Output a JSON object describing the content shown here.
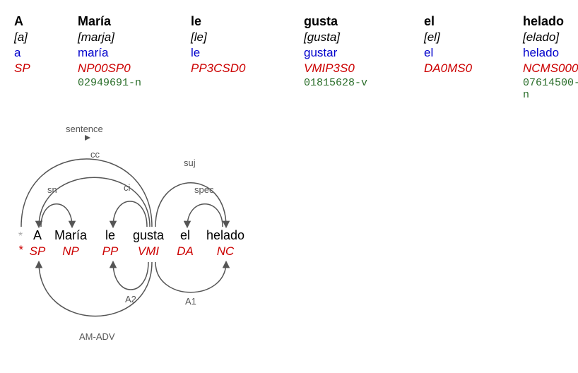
{
  "tokens": [
    {
      "word": "A",
      "phonetic": "[a]",
      "lemma": "a",
      "pos": "SP",
      "sense": ""
    },
    {
      "word": "María",
      "phonetic": "[marja]",
      "lemma": "maría",
      "pos": "NP00SP0",
      "sense": "02949691-n"
    },
    {
      "word": "le",
      "phonetic": "[le]",
      "lemma": "le",
      "pos": "PP3CSD0",
      "sense": ""
    },
    {
      "word": "gusta",
      "phonetic": "[gusta]",
      "lemma": "gustar",
      "pos": "VMIP3S0",
      "sense": "01815628-v"
    },
    {
      "word": "el",
      "phonetic": "[el]",
      "lemma": "el",
      "pos": "DA0MS0",
      "sense": ""
    },
    {
      "word": "helado",
      "phonetic": "[elado]",
      "lemma": "helado",
      "pos": "NCMS000",
      "sense": "07614500-n"
    }
  ],
  "dep": {
    "root_star": "*",
    "root_pos_star": "*",
    "tokens": [
      {
        "word": "A",
        "pos": "SP"
      },
      {
        "word": "María",
        "pos": "NP"
      },
      {
        "word": "le",
        "pos": "PP"
      },
      {
        "word": "gusta",
        "pos": "VMI"
      },
      {
        "word": "el",
        "pos": "DA"
      },
      {
        "word": "helado",
        "pos": "NC"
      }
    ],
    "arcs_top": [
      {
        "label": "sentence",
        "from": 0,
        "to": 4
      },
      {
        "label": "cc",
        "from": 1,
        "to": 4
      },
      {
        "label": "sn",
        "from": 1,
        "to": 2
      },
      {
        "label": "ci",
        "from": 3,
        "to": 4
      },
      {
        "label": "suj",
        "from": 4,
        "to": 6
      },
      {
        "label": "spec",
        "from": 5,
        "to": 6
      }
    ],
    "arcs_bottom": [
      {
        "label": "A2",
        "from": 3,
        "to": 4
      },
      {
        "label": "A1",
        "from": 4,
        "to": 6
      },
      {
        "label": "AM-ADV",
        "from": 1,
        "to": 4
      }
    ]
  },
  "chart_data": {
    "type": "dependency-parse",
    "sentence": "A María le gusta el helado",
    "layers": [
      "surface",
      "phonetic",
      "lemma",
      "pos_full",
      "wordnet_sense"
    ],
    "pos_short": [
      "SP",
      "NP",
      "PP",
      "VMI",
      "DA",
      "NC"
    ],
    "relations_syntactic": [
      "sentence",
      "cc",
      "sn",
      "ci",
      "suj",
      "spec"
    ],
    "relations_semantic": [
      "A2",
      "A1",
      "AM-ADV"
    ]
  }
}
